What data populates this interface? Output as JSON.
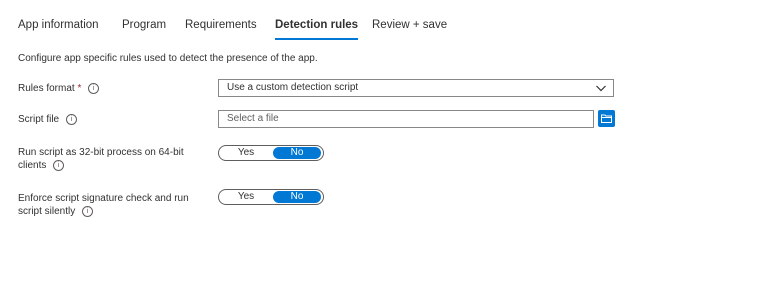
{
  "tabs": [
    {
      "label": "App information",
      "active": false
    },
    {
      "label": "Program",
      "active": false
    },
    {
      "label": "Requirements",
      "active": false
    },
    {
      "label": "Detection rules",
      "active": true
    },
    {
      "label": "Review + save",
      "active": false
    }
  ],
  "description": "Configure app specific rules used to detect the presence of the app.",
  "rules_format": {
    "label": "Rules format",
    "required_marker": "*",
    "value": "Use a custom detection script"
  },
  "script_file": {
    "label": "Script file",
    "placeholder": "Select a file"
  },
  "run_32bit": {
    "label_line1": "Run script as 32-bit process on 64-bit",
    "label_line2": "clients",
    "yes": "Yes",
    "no": "No",
    "selected": "No"
  },
  "enforce_signature": {
    "label_line1": "Enforce script signature check and run",
    "label_line2": "script silently",
    "yes": "Yes",
    "no": "No",
    "selected": "No"
  },
  "info_icon_glyph": "i",
  "colors": {
    "accent": "#0078d4",
    "required": "#a4262c",
    "text": "#323130"
  }
}
